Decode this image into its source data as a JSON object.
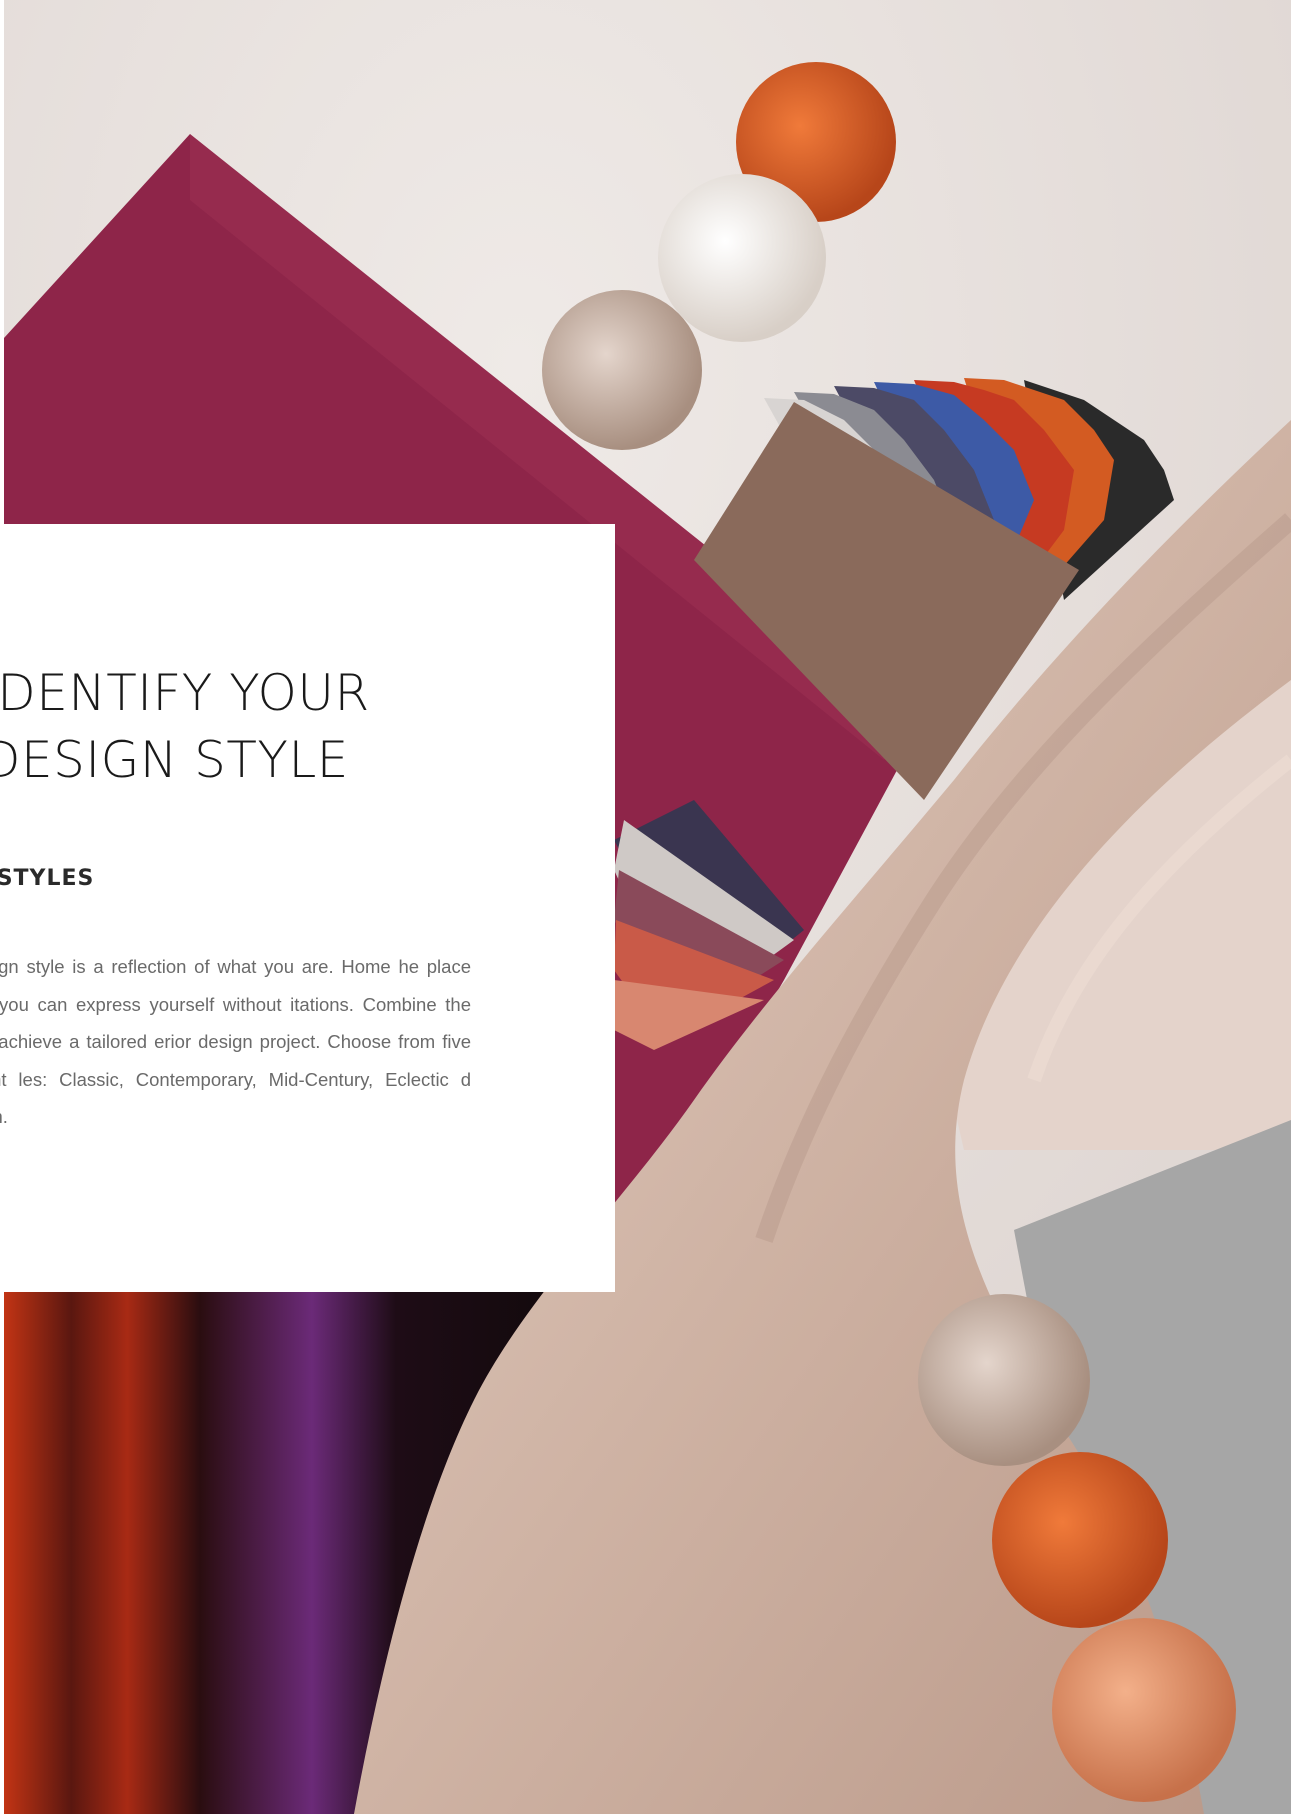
{
  "card": {
    "title_line1": "IDENTIFY YOUR",
    "title_line2": "DESIGN STYLE",
    "subtitle": "E STYLES",
    "paragraph": "ur design style is a reflection of what you are. Home he place where you can express yourself without itations. Combine the two to achieve a tailored erior design project. Choose from five different les: Classic, Contemporary, Mid-Century, Eclectic d Modern."
  },
  "colors": {
    "background": "#e6dedb",
    "burgundy_board": "#8e2549",
    "leather_swatch": "#8a6a5b",
    "velvet": "#d8c0b3",
    "grey_panel": "#a6a6a6",
    "dark_velvet": "#1a0d10",
    "pompom_orange": "#d35b22",
    "pompom_white": "#efe9e2",
    "pompom_taupe": "#c6b0a2"
  }
}
